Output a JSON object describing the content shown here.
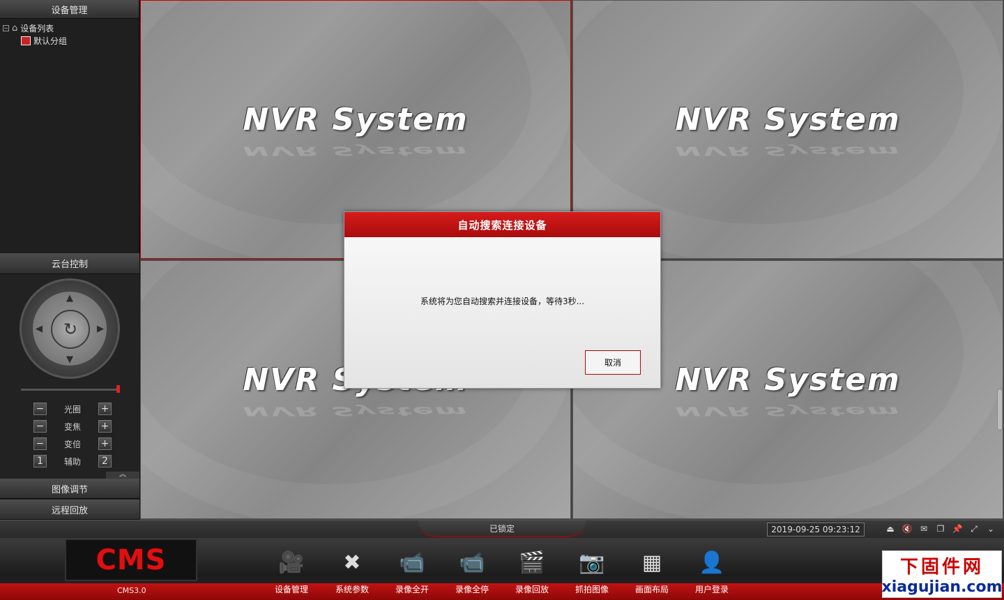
{
  "left_panel": {
    "device_mgmt_title": "设备管理",
    "tree": {
      "root": "设备列表",
      "child": "默认分组"
    },
    "ptz_title": "云台控制",
    "controls": [
      {
        "label": "光圈",
        "minus": "−",
        "plus": "+"
      },
      {
        "label": "变焦",
        "minus": "−",
        "plus": "+"
      },
      {
        "label": "变倍",
        "minus": "−",
        "plus": "+"
      },
      {
        "label": "辅助",
        "minus": "1",
        "plus": "2"
      }
    ],
    "image_adjust": "图像调节",
    "remote_playback": "远程回放",
    "collapse_glyph": "«",
    "collapse_up_glyph": "︽"
  },
  "video": {
    "logo_text": "NVR System"
  },
  "modal": {
    "title": "自动搜索连接设备",
    "message": "系统将为您自动搜索并连接设备，等待3秒...",
    "cancel_label": "取消"
  },
  "status_bar": {
    "locked": "已锁定",
    "datetime": "2019-09-25 09:23:12",
    "icons": [
      "eject-icon",
      "mute-icon",
      "mail-icon",
      "windows-icon",
      "pin-icon",
      "fullscreen-icon",
      "chevron-down-icon"
    ]
  },
  "bottom_bar": {
    "logo": "CMS",
    "version": "CMS3.0",
    "tools": [
      {
        "label": "设备管理",
        "icon": "device-manage-icon"
      },
      {
        "label": "系统参数",
        "icon": "tools-icon"
      },
      {
        "label": "录像全开",
        "icon": "record-all-on-icon"
      },
      {
        "label": "录像全停",
        "icon": "record-all-stop-icon"
      },
      {
        "label": "录像回放",
        "icon": "clapper-icon"
      },
      {
        "label": "抓拍图像",
        "icon": "camera-icon"
      },
      {
        "label": "画面布局",
        "icon": "layout-icon"
      },
      {
        "label": "用户登录",
        "icon": "user-icon"
      }
    ]
  },
  "watermark": {
    "cn": "下固件网",
    "url": "xiagujian.com"
  },
  "colors": {
    "accent_red": "#c21212",
    "panel_dark": "#1f1f1f"
  }
}
